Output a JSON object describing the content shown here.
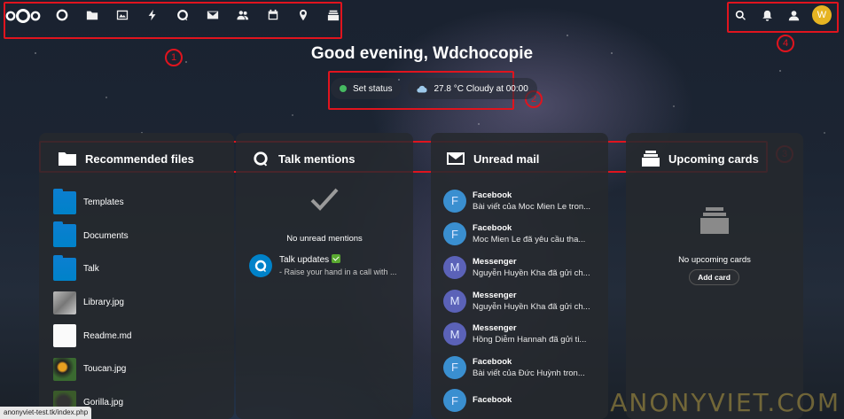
{
  "header": {
    "nav_icons": [
      "dashboard-icon",
      "files-icon",
      "photos-icon",
      "activity-icon",
      "talk-icon",
      "mail-icon",
      "contacts-icon",
      "calendar-icon",
      "maps-icon",
      "deck-icon"
    ],
    "right_icons": [
      "search-icon",
      "notifications-icon",
      "contacts-menu-icon"
    ],
    "avatar_initial": "W"
  },
  "greeting": "Good evening, Wdchocopie",
  "status": {
    "set_status": "Set status",
    "weather": "27.8 °C Cloudy at 00:00",
    "status_color": "#46ba61"
  },
  "annotations": [
    "1",
    "2",
    "3",
    "4"
  ],
  "panels": {
    "files": {
      "title": "Recommended files",
      "items": [
        {
          "name": "Templates",
          "type": "folder"
        },
        {
          "name": "Documents",
          "type": "folder"
        },
        {
          "name": "Talk",
          "type": "folder"
        },
        {
          "name": "Library.jpg",
          "type": "image"
        },
        {
          "name": "Readme.md",
          "type": "text"
        },
        {
          "name": "Toucan.jpg",
          "type": "image"
        },
        {
          "name": "Gorilla.jpg",
          "type": "image"
        }
      ]
    },
    "talk": {
      "title": "Talk mentions",
      "empty": "No unread mentions",
      "item_title": "Talk updates",
      "item_sub": "- Raise your hand in a call with ..."
    },
    "mail": {
      "title": "Unread mail",
      "items": [
        {
          "from": "Facebook",
          "subject": "Bài viết của Moc Mien Le tron...",
          "initial": "F",
          "color": "#3a8fd0"
        },
        {
          "from": "Facebook",
          "subject": "Moc Mien Le đã yêu cầu tha...",
          "initial": "F",
          "color": "#3a8fd0"
        },
        {
          "from": "Messenger",
          "subject": "Nguyễn Huyền Kha đã gửi ch...",
          "initial": "M",
          "color": "#5b62b8"
        },
        {
          "from": "Messenger",
          "subject": "Nguyễn Huyền Kha đã gửi ch...",
          "initial": "M",
          "color": "#5b62b8"
        },
        {
          "from": "Messenger",
          "subject": "Hồng Diễm Hannah đã gửi ti...",
          "initial": "M",
          "color": "#5b62b8"
        },
        {
          "from": "Facebook",
          "subject": "Bài viết của Đức Huỳnh tron...",
          "initial": "F",
          "color": "#3a8fd0"
        },
        {
          "from": "Facebook",
          "subject": "",
          "initial": "F",
          "color": "#3a8fd0"
        }
      ]
    },
    "cards": {
      "title": "Upcoming cards",
      "empty": "No upcoming cards",
      "add_label": "Add card"
    }
  },
  "status_url": "anonyviet-test.tk/index.php",
  "watermark": "ANONYVIET.COM",
  "accent_red": "#e0141e"
}
